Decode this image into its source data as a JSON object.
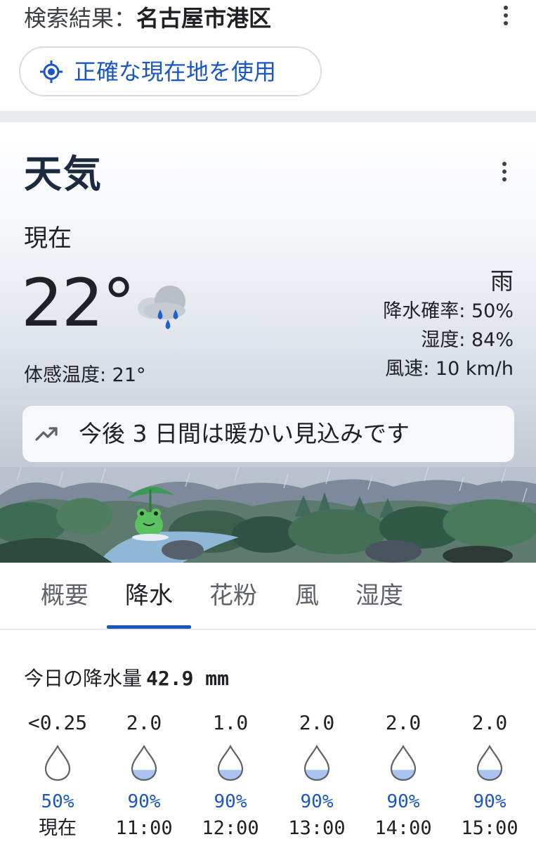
{
  "search": {
    "label": "検索結果：",
    "place": "名古屋市港区",
    "location_button": "正確な現在地を使用",
    "location_icon": "my-location-icon"
  },
  "weather": {
    "heading": "天気",
    "now_label": "現在",
    "temperature": "22°",
    "condition_icon": "rain-cloud-icon",
    "feels_like": "体感温度: 21°",
    "condition": "雨",
    "precip_chance": "降水確率: 50%",
    "humidity": "湿度: 84%",
    "wind": "風速: 10 km/h",
    "forecast_icon": "trending-up-icon",
    "forecast_text": "今後 3 日間は暖かい見込みです"
  },
  "tabs": [
    {
      "label": "概要",
      "active": false
    },
    {
      "label": "降水",
      "active": true
    },
    {
      "label": "花粉",
      "active": false
    },
    {
      "label": "風",
      "active": false
    },
    {
      "label": "湿度",
      "active": false
    }
  ],
  "precipitation": {
    "total_label": "今日の降水量",
    "total_value": "42.9 mm",
    "hours": [
      {
        "amount": "<0.25",
        "prob": "50%",
        "time": "現在",
        "fill": 0
      },
      {
        "amount": "2.0",
        "prob": "90%",
        "time": "11:00",
        "fill": 0.3
      },
      {
        "amount": "1.0",
        "prob": "90%",
        "time": "12:00",
        "fill": 0.3
      },
      {
        "amount": "2.0",
        "prob": "90%",
        "time": "13:00",
        "fill": 0.3
      },
      {
        "amount": "2.0",
        "prob": "90%",
        "time": "14:00",
        "fill": 0.3
      },
      {
        "amount": "2.0",
        "prob": "90%",
        "time": "15:00",
        "fill": 0.3
      }
    ]
  },
  "colors": {
    "accent_blue": "#1a56c4",
    "drop_fill": "#a9c4f0"
  }
}
